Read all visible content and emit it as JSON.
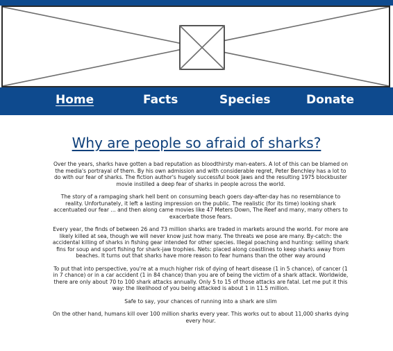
{
  "hero": {
    "image_icon": "image-placeholder-icon"
  },
  "nav": {
    "items": [
      {
        "label": "Home",
        "active": true
      },
      {
        "label": "Facts",
        "active": false
      },
      {
        "label": "Species",
        "active": false
      },
      {
        "label": "Donate",
        "active": false
      }
    ]
  },
  "main": {
    "title": "Why are people so afraid of sharks?",
    "paragraphs": [
      "Over the years, sharks have gotten a bad reputation as bloodthirsty man-eaters. A lot of this can be blamed on the media's portrayal of them. By his own admission and with considerable regret, Peter Benchley has a lot to do with our fear of sharks. The fiction author's hugely successful book Jaws and the resulting 1975 blockbuster movie instilled a deep fear of sharks in people across the world.",
      "The story of a rampaging shark hell bent on consuming beach goers day-after-day has no resemblance to reality. Unfortunately, it left a lasting impression on the public.  The realistic (for its time) looking shark accentuated our fear ... and then along came movies like 47 Meters Down, The Reef and many, many others to exacerbate those fears.",
      "Every year, the finds of between 26 and 73 million sharks are traded in markets around the world. For more are likely killed at sea, though we will never know just how many. The threats we pose are many. By-catch: the accidental killing of sharks in fishing gear intended for other species. Illegal poaching and hunting: selling shark fins for soup and sport fishing for shark-jaw trophies. Nets: placed along coastlines to keep sharks away from beaches. It turns out that sharks have more reason to fear humans than the other way around",
      "To put that into perspective, you're at a much higher risk of dying of heart disease (1 in 5 chance), of cancer (1 in 7 chance) or in a car accident (1 in 84 chance) than you are of being the victim of a shark attack. Worldwide, there are only about 70 to 100 shark attacks annually. Only 5 to 15 of those attacks are fatal. Let me put it this way: the likelihood of you being attacked is about 1 in 11.5 million.",
      "Safe to say, your chances of running into a shark are slim",
      "On the other hand, humans kill over 100 million sharks every year. This works out to about 11,000 sharks dying every hour."
    ]
  },
  "colors": {
    "brand_blue": "#0e4a8e",
    "title_blue": "#0e3f7a",
    "text": "#1a1a1a"
  }
}
